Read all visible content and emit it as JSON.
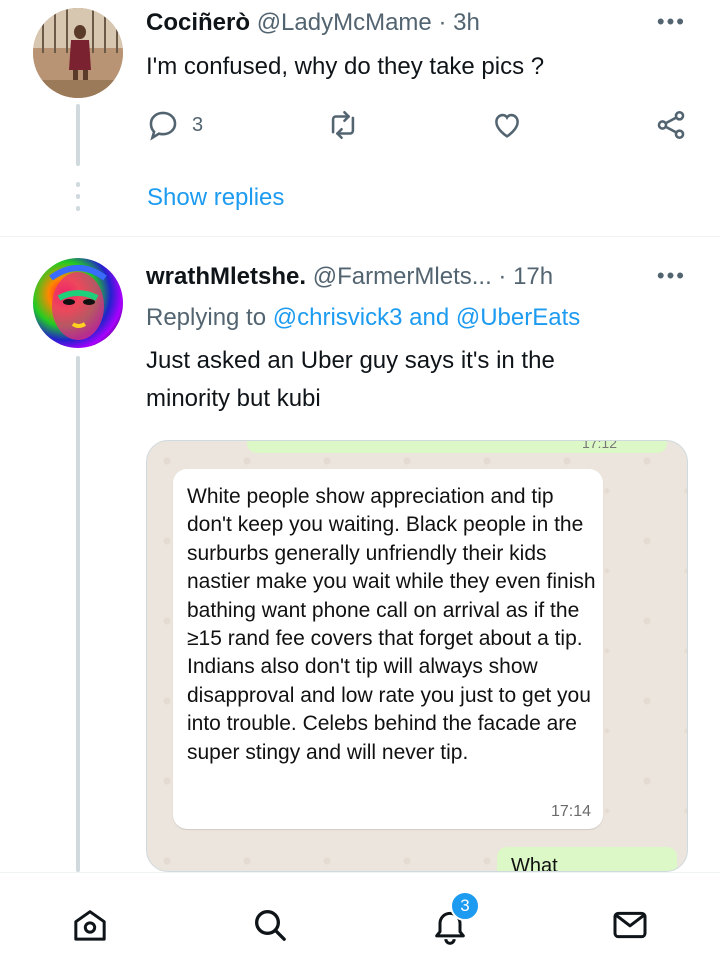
{
  "tweet1": {
    "name": "Cociñerò",
    "handle": "@LadyMcMame",
    "time": "· 3h",
    "text": "I'm confused, why do they take pics ?",
    "reply_count": "3",
    "show_replies": "Show replies"
  },
  "tweet2": {
    "name": "wrathMletshe.",
    "handle": "@FarmerMlets...",
    "time": "· 17h",
    "replying_prefix": "Replying to",
    "replying_user1": "@chrisvick3",
    "replying_and": "and",
    "replying_user2": "@UberEats",
    "text_line1": "Just asked an Uber guy says it's in the",
    "text_line2": "minority but kubi",
    "media": {
      "top_time": "17:12",
      "message": "White people show appreciation and tip don't keep you waiting. Black people in the surburbs generally unfriendly their kids nastier make you wait while they even finish bathing want phone call on arrival as if the ≥15 rand fee covers that forget about a tip. Indians also don't tip will always show disapproval and low rate you just to get you into trouble. Celebs behind the facade are super stingy and will never tip.",
      "message_time": "17:14",
      "reply_preview": "What"
    }
  },
  "nav": {
    "notifications_badge": "3"
  },
  "colors": {
    "accent": "#1d9bf0",
    "secondary_text": "#536471",
    "chat_background": "#ece5dd",
    "outgoing_bubble": "#dcf8c6"
  }
}
